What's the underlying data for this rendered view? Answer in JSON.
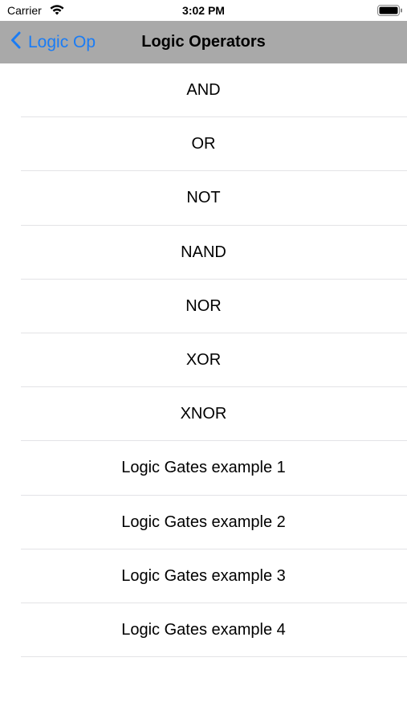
{
  "status_bar": {
    "carrier": "Carrier",
    "time": "3:02 PM",
    "wifi_icon": "wifi-icon",
    "battery_icon": "battery-icon"
  },
  "nav": {
    "back_label": "Logic Op",
    "title": "Logic Operators",
    "accent_color": "#1a7cf5",
    "bar_color": "#a9a9a9"
  },
  "list": {
    "items": [
      {
        "label": "AND"
      },
      {
        "label": "OR"
      },
      {
        "label": "NOT"
      },
      {
        "label": "NAND"
      },
      {
        "label": "NOR"
      },
      {
        "label": "XOR"
      },
      {
        "label": "XNOR"
      },
      {
        "label": "Logic Gates example 1"
      },
      {
        "label": "Logic Gates example 2"
      },
      {
        "label": "Logic Gates example 3"
      },
      {
        "label": "Logic Gates example 4"
      }
    ]
  }
}
